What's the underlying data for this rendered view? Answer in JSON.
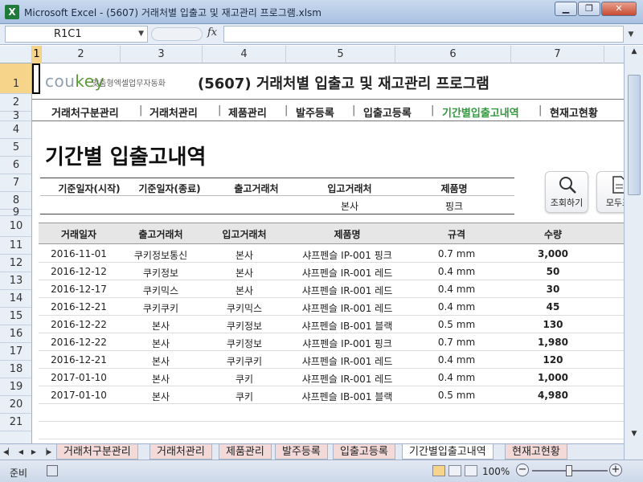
{
  "window": {
    "title": "Microsoft Excel - (5607) 거래처별 입출고 및 재고관리 프로그램.xlsm",
    "app_icon": "X"
  },
  "formula_bar": {
    "name_box": "R1C1",
    "fx": "fx",
    "formula": ""
  },
  "columns": [
    "1",
    "2",
    "3",
    "4",
    "5",
    "6",
    "7"
  ],
  "rows": [
    "1",
    "2",
    "3",
    "4",
    "5",
    "6",
    "7",
    "8",
    "9",
    "10",
    "11",
    "12",
    "13",
    "14",
    "15",
    "16",
    "17",
    "18",
    "19",
    "20",
    "21"
  ],
  "header": {
    "brand_cou": "cou",
    "brand_key": "key",
    "brand_sub": "맞춤형엑셀업무자동화",
    "doc_title": "(5607) 거래처별 입출고 및 재고관리 프로그램"
  },
  "nav": {
    "items": [
      "거래처구분관리",
      "거래처관리",
      "제품관리",
      "발주등록",
      "입출고등록",
      "기간별입출고내역",
      "현재고현황"
    ],
    "separator": "|",
    "active_index": 5
  },
  "page_title": "기간별 입출고내역",
  "filter": {
    "headers": [
      "기준일자(시작)",
      "기준일자(종료)",
      "출고거래처",
      "입고거래처",
      "제품명"
    ],
    "values": [
      "",
      "",
      "",
      "본사",
      "핑크"
    ]
  },
  "buttons": {
    "search": "조회하기",
    "show_all": "모두표"
  },
  "table": {
    "headers": [
      "거래일자",
      "출고거래처",
      "입고거래처",
      "제품명",
      "규격",
      "수량"
    ],
    "rows": [
      [
        "2016-11-01",
        "쿠키정보통신",
        "본사",
        "샤프펜슬 IP-001 핑크",
        "0.7 mm",
        "3,000"
      ],
      [
        "2016-12-12",
        "쿠키정보",
        "본사",
        "샤프펜슬 IR-001 레드",
        "0.4 mm",
        "50"
      ],
      [
        "2016-12-17",
        "쿠키믹스",
        "본사",
        "샤프펜슬 IR-001 레드",
        "0.4 mm",
        "30"
      ],
      [
        "2016-12-21",
        "쿠키쿠키",
        "쿠키믹스",
        "샤프펜슬 IR-001 레드",
        "0.4 mm",
        "45"
      ],
      [
        "2016-12-22",
        "본사",
        "쿠키정보",
        "샤프펜슬 IB-001 블랙",
        "0.5 mm",
        "130"
      ],
      [
        "2016-12-22",
        "본사",
        "쿠키정보",
        "샤프펜슬 IP-001 핑크",
        "0.7 mm",
        "1,980"
      ],
      [
        "2016-12-21",
        "본사",
        "쿠키쿠키",
        "샤프펜슬 IR-001 레드",
        "0.4 mm",
        "120"
      ],
      [
        "2017-01-10",
        "본사",
        "쿠키",
        "샤프펜슬 IR-001 레드",
        "0.4 mm",
        "1,000"
      ],
      [
        "2017-01-10",
        "본사",
        "쿠키",
        "샤프펜슬 IB-001 블랙",
        "0.5 mm",
        "4,980"
      ]
    ]
  },
  "sheet_tabs": [
    "거래처구분관리",
    "거래처관리",
    "제품관리",
    "발주등록",
    "입출고등록",
    "기간별입출고내역",
    "현재고현황"
  ],
  "active_tab_index": 5,
  "status": {
    "ready": "준비",
    "zoom": "100%"
  },
  "colors": {
    "accent_green": "#2f9a3a",
    "selection": "#f6d58a",
    "tab_pink": "#f4d9d9"
  }
}
